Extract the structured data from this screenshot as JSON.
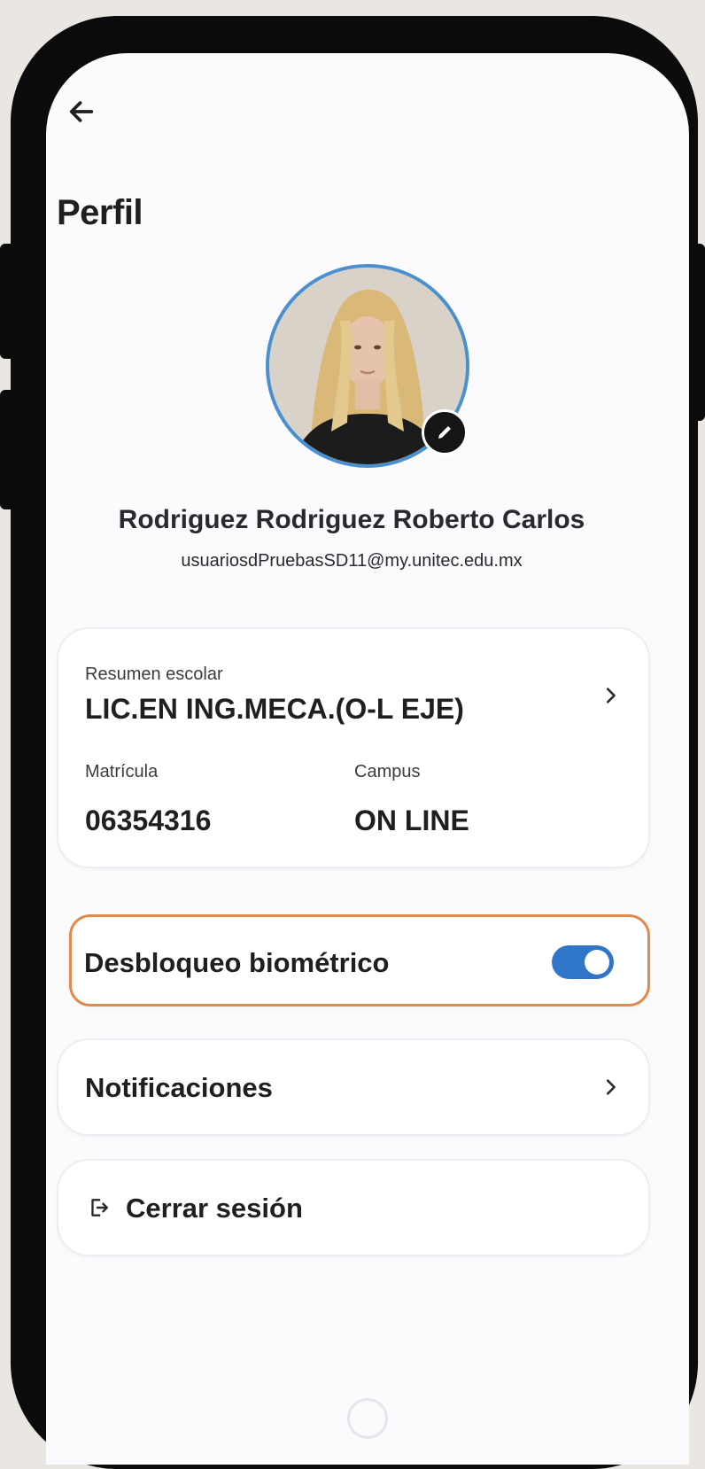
{
  "header": {
    "back_icon": "arrow-left-icon",
    "title": "Perfil"
  },
  "profile": {
    "avatar_alt": "profile photo",
    "edit_icon": "pencil-icon",
    "name": "Rodriguez Rodriguez Roberto Carlos",
    "email": "usuariosdPruebasSD11@my.unitec.edu.mx"
  },
  "summary": {
    "label": "Resumen escolar",
    "program": "LIC.EN ING.MECA.(O-L EJE)",
    "matricula_label": "Matrícula",
    "matricula_value": "06354316",
    "campus_label": "Campus",
    "campus_value": "ON LINE",
    "chevron_icon": "chevron-right-icon"
  },
  "biometric": {
    "label": "Desbloqueo biométrico",
    "enabled": true
  },
  "notifications": {
    "label": "Notificaciones",
    "chevron_icon": "chevron-right-icon"
  },
  "logout": {
    "icon": "logout-icon",
    "label": "Cerrar sesión"
  },
  "colors": {
    "accent": "#2f76c9",
    "avatar_ring": "#4a90cf",
    "highlight_border": "#e08a4e",
    "text_primary": "#1f1f22"
  }
}
